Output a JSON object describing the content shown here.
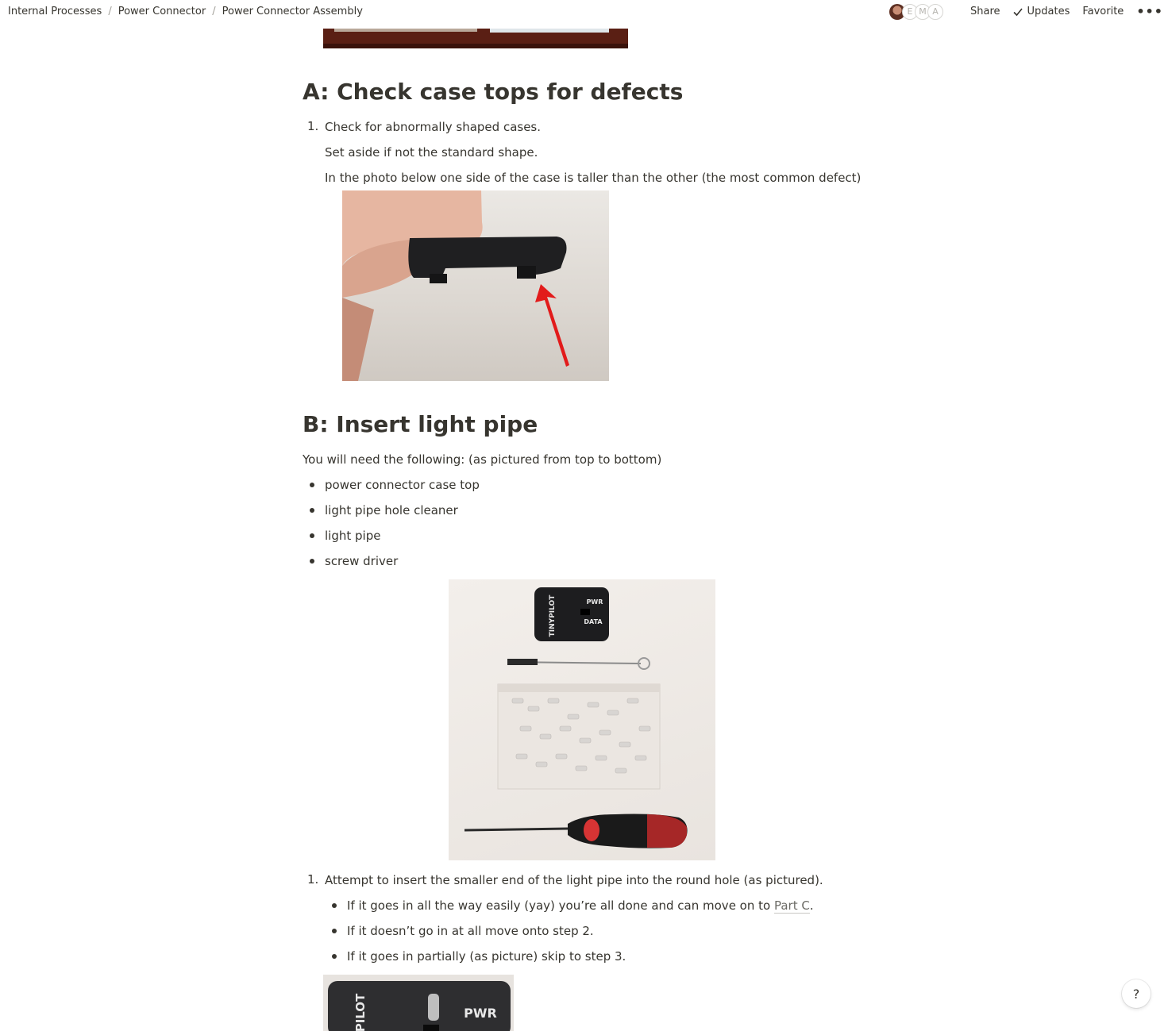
{
  "breadcrumb": [
    "Internal Processes",
    "Power Connector",
    "Power Connector Assembly"
  ],
  "collaborators": [
    "E",
    "M",
    "A"
  ],
  "topbar": {
    "share": "Share",
    "updates": "Updates",
    "favorite": "Favorite",
    "more": "•••"
  },
  "sectionA": {
    "heading": "A: Check case tops for defects",
    "step_num": "1.",
    "step1": "Check for abnormally shaped cases.",
    "line2": "Set aside if not the standard shape.",
    "line3": "In the photo below one side of the case is taller than the other (the most common defect)"
  },
  "sectionB": {
    "heading": "B: Insert light pipe",
    "intro": "You will need the following: (as pictured from top to bottom)",
    "items": [
      "power connector case top",
      "light pipe hole cleaner",
      "light pipe",
      "screw driver"
    ],
    "step_num": "1.",
    "step1": "Attempt to insert the smaller end of the light pipe into the round hole (as pictured).",
    "sub1_prefix": "If it goes in all the way easily (yay) you’re all done and can move on to ",
    "sub1_link": "Part C",
    "sub1_suffix": ".",
    "sub2": "If it doesn’t go in at all move onto step 2.",
    "sub3": "If it goes in partially (as picture) skip to step 3."
  },
  "photo_text": {
    "brand_vertical": "TINYPILOT",
    "pwr": "PWR",
    "data": "DATA",
    "brand_partial": "PILOT"
  },
  "help": "?"
}
